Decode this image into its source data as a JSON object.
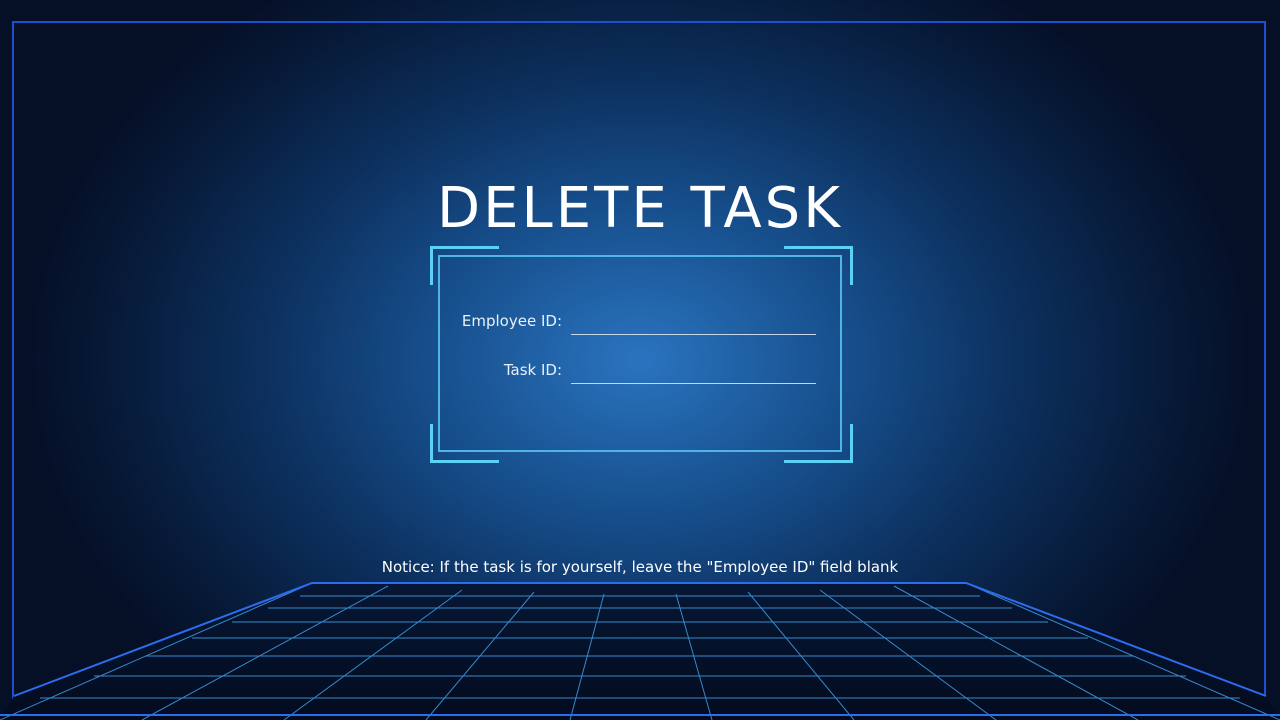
{
  "page": {
    "title": "DELETE TASK",
    "notice": "Notice: If the task is for yourself, leave the \"Employee ID\" field blank"
  },
  "form": {
    "employee_id": {
      "label": "Employee ID:",
      "value": ""
    },
    "task_id": {
      "label": "Task ID:",
      "value": ""
    }
  },
  "colors": {
    "accent": "#5cd0f5",
    "frame": "#1e4fd0",
    "grid": "#3f9fe8"
  }
}
